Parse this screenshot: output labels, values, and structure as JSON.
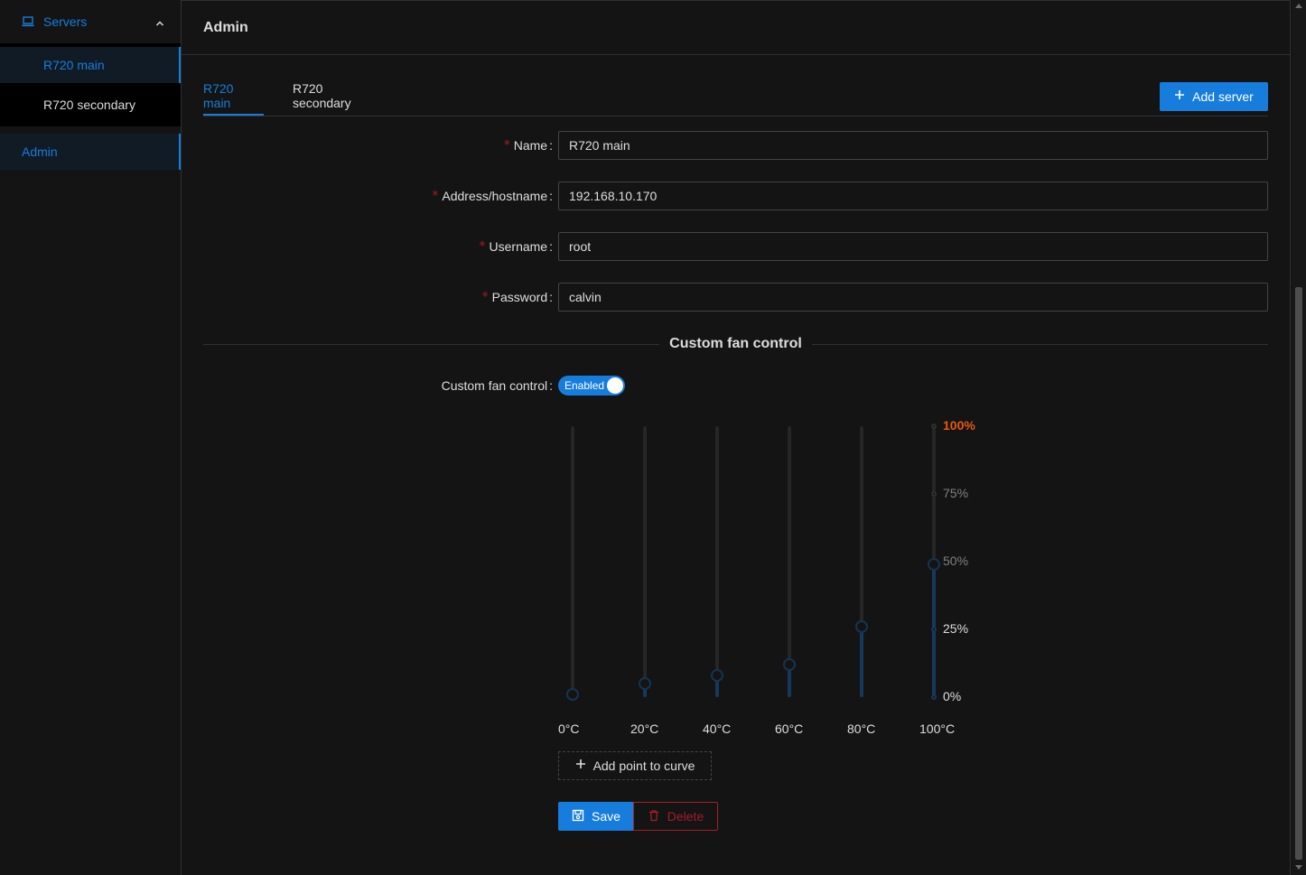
{
  "sidebar": {
    "submenu_label": "Servers",
    "submenu_icon": "laptop-icon",
    "items": [
      {
        "label": "R720 main",
        "active": true
      },
      {
        "label": "R720 secondary",
        "active": false
      }
    ],
    "admin_label": "Admin"
  },
  "header": {
    "title": "Admin"
  },
  "tabs": [
    {
      "label": "R720 main",
      "active": true
    },
    {
      "label": "R720 secondary",
      "active": false
    }
  ],
  "add_server_label": "Add server",
  "form": {
    "name": {
      "label": "Name",
      "value": "R720 main"
    },
    "address": {
      "label": "Address/hostname",
      "value": "192.168.10.170"
    },
    "username": {
      "label": "Username",
      "value": "root"
    },
    "password": {
      "label": "Password",
      "value": "calvin"
    }
  },
  "fan_section": {
    "divider_title": "Custom fan control",
    "switch_label": "Custom fan control",
    "switch_text": "Enabled",
    "enabled": true
  },
  "fan_curve": [
    {
      "temp": "0°C",
      "percent": 1
    },
    {
      "temp": "20°C",
      "percent": 5
    },
    {
      "temp": "40°C",
      "percent": 8
    },
    {
      "temp": "60°C",
      "percent": 12
    },
    {
      "temp": "80°C",
      "percent": 26
    },
    {
      "temp": "100°C",
      "percent": 49
    }
  ],
  "marks": [
    "0%",
    "25%",
    "50%",
    "75%",
    "100%"
  ],
  "add_point_label": "Add point to curve",
  "save_label": "Save",
  "delete_label": "Delete",
  "colors": {
    "accent": "#177ddc",
    "danger": "#a61d24",
    "max_mark": "#e8590c"
  }
}
